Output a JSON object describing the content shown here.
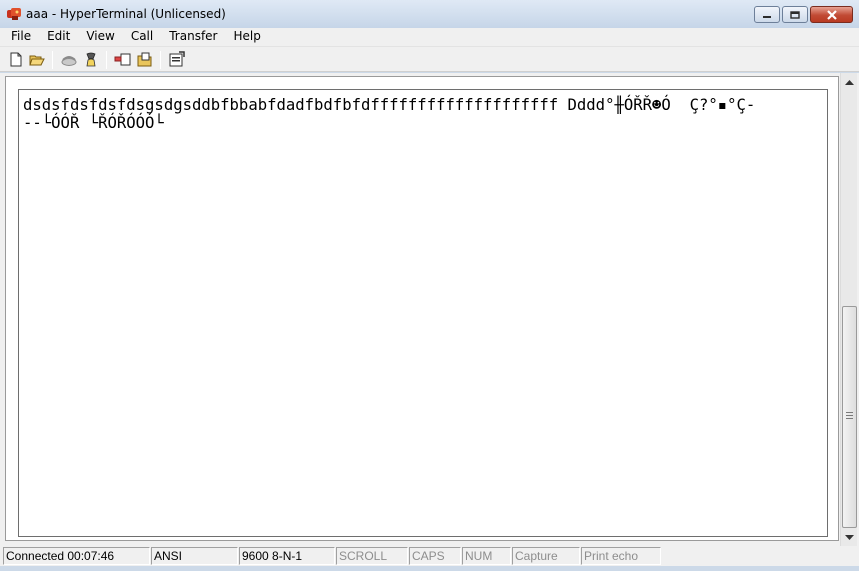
{
  "window": {
    "title": "aaa - HyperTerminal (Unlicensed)",
    "app_icon": "hyperterminal-icon",
    "buttons": [
      "minimize-icon",
      "maximize-icon",
      "close-icon"
    ]
  },
  "menu": {
    "items": [
      "File",
      "Edit",
      "View",
      "Call",
      "Transfer",
      "Help"
    ]
  },
  "toolbar": {
    "icons": [
      "new-icon",
      "open-icon",
      "connect-icon",
      "disconnect-icon",
      "send-icon",
      "receive-icon",
      "properties-icon"
    ]
  },
  "terminal": {
    "lines": [
      "dsdsfdsfdsfdsgsdgsddbfbbabfdadfbdfbfdffffffffffffffffffff Dddd°╫ÓŘŘ☻Ó  Ç?°▪°Ç-",
      "--└ÓÓŘ └ŘÓŘÓÓÓ└"
    ]
  },
  "status": {
    "connection": "Connected 00:07:46",
    "emulation": "ANSI",
    "port_settings": "9600 8-N-1",
    "scroll": "SCROLL",
    "caps": "CAPS",
    "num": "NUM",
    "capture": "Capture",
    "print_echo": "Print echo"
  },
  "colors": {
    "titlebar": "#c6d5e8",
    "chrome": "#f0f0f0",
    "terminal_bg": "#ffffff",
    "close_button": "#c14a34",
    "status_dim_text": "#8d8d8d"
  }
}
